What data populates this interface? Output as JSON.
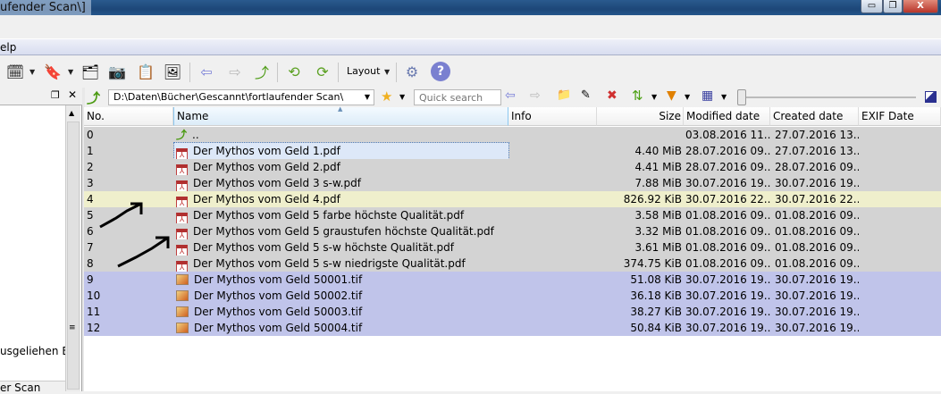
{
  "window": {
    "title": "ufender Scan\\]",
    "min": "▭",
    "restore": "❐",
    "close": "X"
  },
  "menu": {
    "help": "elp"
  },
  "toolbar": {
    "layout_label": "Layout"
  },
  "left_panel": {
    "items": [
      "usgeliehen Bib",
      "er Scan"
    ]
  },
  "path": {
    "value": "D:\\Daten\\Bücher\\Gescannt\\fortlaufender Scan\\",
    "search_placeholder": "Quick search"
  },
  "columns": [
    "No.",
    "Name",
    "Info",
    "Size",
    "Modified date",
    "Created date",
    "EXIF Date"
  ],
  "rows": [
    {
      "no": "0",
      "name": "..",
      "type": "up",
      "size": "",
      "modified": "03.08.2016 11...",
      "created": "27.07.2016 13..."
    },
    {
      "no": "1",
      "name": "Der Mythos vom Geld 1.pdf",
      "type": "pdf",
      "size": "4.40 MiB",
      "modified": "28.07.2016 09...",
      "created": "27.07.2016 13..."
    },
    {
      "no": "2",
      "name": "Der Mythos vom Geld 2.pdf",
      "type": "pdf",
      "size": "4.41 MiB",
      "modified": "28.07.2016 09...",
      "created": "28.07.2016 09..."
    },
    {
      "no": "3",
      "name": "Der Mythos vom Geld 3 s-w.pdf",
      "type": "pdf",
      "size": "7.88 MiB",
      "modified": "30.07.2016 19...",
      "created": "30.07.2016 19..."
    },
    {
      "no": "4",
      "name": "Der Mythos vom Geld 4.pdf",
      "type": "pdf",
      "size": "826.92 KiB",
      "modified": "30.07.2016 22...",
      "created": "30.07.2016 22..."
    },
    {
      "no": "5",
      "name": "Der Mythos vom Geld 5 farbe höchste Qualität.pdf",
      "type": "pdf",
      "size": "3.58 MiB",
      "modified": "01.08.2016 09...",
      "created": "01.08.2016 09..."
    },
    {
      "no": "6",
      "name": "Der Mythos vom Geld 5 graustufen höchste Qualität.pdf",
      "type": "pdf",
      "size": "3.32 MiB",
      "modified": "01.08.2016 09...",
      "created": "01.08.2016 09..."
    },
    {
      "no": "7",
      "name": "Der Mythos vom Geld 5 s-w höchste Qualität.pdf",
      "type": "pdf",
      "size": "3.61 MiB",
      "modified": "01.08.2016 09...",
      "created": "01.08.2016 09..."
    },
    {
      "no": "8",
      "name": "Der Mythos vom Geld 5 s-w niedrigste Qualität.pdf",
      "type": "pdf",
      "size": "374.75 KiB",
      "modified": "01.08.2016 09...",
      "created": "01.08.2016 09..."
    },
    {
      "no": "9",
      "name": "Der Mythos vom Geld 50001.tif",
      "type": "tif",
      "size": "51.08 KiB",
      "modified": "30.07.2016 19...",
      "created": "30.07.2016 19..."
    },
    {
      "no": "10",
      "name": "Der Mythos vom Geld 50002.tif",
      "type": "tif",
      "size": "36.18 KiB",
      "modified": "30.07.2016 19...",
      "created": "30.07.2016 19..."
    },
    {
      "no": "11",
      "name": "Der Mythos vom Geld 50003.tif",
      "type": "tif",
      "size": "38.27 KiB",
      "modified": "30.07.2016 19...",
      "created": "30.07.2016 19..."
    },
    {
      "no": "12",
      "name": "Der Mythos vom Geld 50004.tif",
      "type": "tif",
      "size": "50.84 KiB",
      "modified": "30.07.2016 19...",
      "created": "30.07.2016 19..."
    }
  ]
}
